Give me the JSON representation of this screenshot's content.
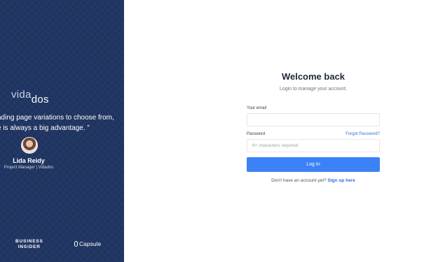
{
  "sidebar": {
    "logo": {
      "part1": "vida",
      "part2": "dos"
    },
    "quote": {
      "line1": "ading page variations to choose from,",
      "line2": "e is always a big advantage. ”"
    },
    "testimonial": {
      "name": "Lida Reidy",
      "role": "Project Manager | Vidados"
    },
    "brands": {
      "business_insider_line1": "BUSINESS",
      "business_insider_line2": "INSIDER",
      "capsule": "Capsule"
    },
    "background_color": "#1f3460"
  },
  "login": {
    "title": "Welcome back",
    "subtitle": "Login to manage your account.",
    "email_label": "Your email",
    "email_value": "",
    "email_placeholder": "",
    "password_label": "Password",
    "forgot_password": "Forgot Password?",
    "password_placeholder": "8+ characters required",
    "submit_label": "Log In",
    "signup_prompt": "Don't have an account yet?",
    "signup_link": "Sign up here",
    "accent_color": "#3b82f6"
  }
}
